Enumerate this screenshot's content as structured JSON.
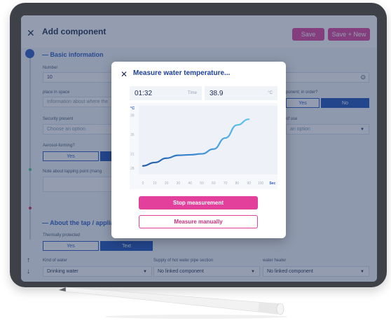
{
  "header": {
    "title": "Add component",
    "save_label": "Save",
    "save_new_label": "Save + New"
  },
  "basic": {
    "section_title": "Basic information",
    "number_label": "Number",
    "number_value": "10",
    "place_label": "place in space",
    "place_placeholder": "Information about where the",
    "security_label": "Security present",
    "security_placeholder": "Choose an option",
    "aerosol_label": "Aerosol-forming?",
    "aerosol_yes": "Yes",
    "note_label": "Note about tapping point (mang",
    "order_label": "ponent; in order?",
    "order_yes": "Yes",
    "order_no": "No",
    "use_label": "of use",
    "use_placeholder": "an option"
  },
  "tap": {
    "section_title": "About the tap / applia",
    "thermal_label": "Thermally protected",
    "thermal_yes": "Yes",
    "thermal_text": "Text",
    "kind_label": "Kind of water",
    "kind_value": "Drinking water",
    "supply_label": "Supply of hot water pipe section",
    "supply_value": "No linked component",
    "heater_label": "water heater",
    "heater_value": "No linked component"
  },
  "modal": {
    "title": "Measure water temperature...",
    "time_value": "01:32",
    "time_label": "Time",
    "temp_value": "38.9",
    "temp_unit": "°C",
    "stop_label": "Stop measurement",
    "manual_label": "Measure manually"
  },
  "chart_data": {
    "type": "line",
    "ylabel": "°C",
    "xlabel": "Sec",
    "y_ticks": [
      "39",
      "35",
      "31",
      "28"
    ],
    "x_ticks": [
      "0",
      "10",
      "20",
      "30",
      "40",
      "50",
      "60",
      "70",
      "80",
      "90",
      "100",
      "Sec"
    ],
    "x": [
      0,
      10,
      20,
      30,
      40,
      50,
      60,
      70,
      80,
      90
    ],
    "y": [
      28.5,
      29.2,
      30.1,
      30.7,
      30.8,
      31.0,
      32.0,
      34.3,
      37.0,
      38.2
    ],
    "colors": [
      "#1e5aa8",
      "#5ec6f0"
    ]
  },
  "colors": {
    "accent": "#e2409a",
    "primary": "#2b59c3"
  }
}
